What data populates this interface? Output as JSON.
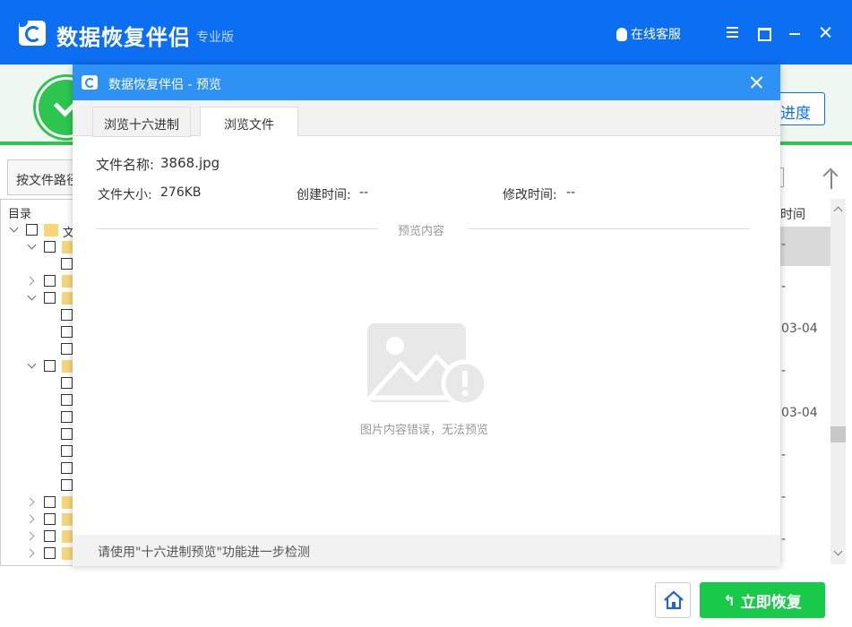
{
  "app": {
    "title": "数据恢复伴侣",
    "edition": "专业版",
    "service": "在线客服"
  },
  "background": {
    "progress_button": "进度",
    "path_button": "按文件路径",
    "tree_header": "目录",
    "tree_root_label": "文",
    "column_header": "时间",
    "column_values": [
      "-",
      "-",
      "03-04",
      "-",
      "03-04",
      "-",
      "-",
      "-"
    ],
    "recover_button": "立即恢复"
  },
  "dialog": {
    "title": "数据恢复伴侣 - 预览",
    "tabs": [
      {
        "label": "浏览十六进制",
        "active": false
      },
      {
        "label": "浏览文件",
        "active": true
      }
    ],
    "file_name_label": "文件名称:",
    "file_name": "3868.jpg",
    "file_size_label": "文件大小:",
    "file_size": "276KB",
    "created_label": "创建时间:",
    "created": "--",
    "modified_label": "修改时间:",
    "modified": "--",
    "section_label": "预览内容",
    "error_text": "图片内容错误，无法预览",
    "footer_note": "请使用\"十六进制预览\"功能进一步检测"
  },
  "colors": {
    "brand_blue": "#0c6ff2",
    "dialog_blue": "#2d92f3",
    "success_green": "#19c94a"
  }
}
